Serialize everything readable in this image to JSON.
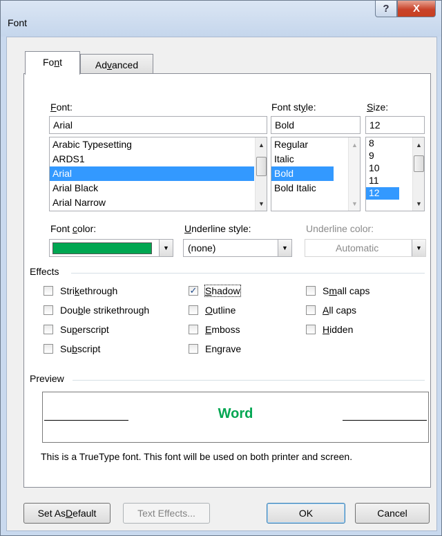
{
  "window": {
    "title": "Font",
    "help_label": "?",
    "close_label": "X"
  },
  "tabs": [
    {
      "label_pre": "Fo",
      "label_u": "n",
      "label_post": "t",
      "active": true
    },
    {
      "label_pre": "Ad",
      "label_u": "v",
      "label_post": "anced",
      "active": false
    }
  ],
  "font": {
    "label_u": "F",
    "label_post": "ont:",
    "value": "Arial",
    "list": [
      "Arabic Typesetting",
      "ARDS1",
      "Arial",
      "Arial Black",
      "Arial Narrow"
    ],
    "selected": "Arial"
  },
  "font_style": {
    "label_pre": "Font st",
    "label_u": "y",
    "label_post": "le:",
    "value": "Bold",
    "list": [
      "Regular",
      "Italic",
      "Bold",
      "Bold Italic"
    ],
    "selected": "Bold"
  },
  "size": {
    "label_u": "S",
    "label_post": "ize:",
    "value": "12",
    "list": [
      "8",
      "9",
      "10",
      "11",
      "12"
    ],
    "selected": "12"
  },
  "font_color": {
    "label_pre": "Font ",
    "label_u": "c",
    "label_post": "olor:",
    "color": "#00a651"
  },
  "underline_style": {
    "label_u": "U",
    "label_post": "nderline style:",
    "value": "(none)"
  },
  "underline_color": {
    "label": "Underline color:",
    "value": "Automatic",
    "disabled": true
  },
  "effects": {
    "heading": "Effects",
    "items": [
      {
        "pre": "Stri",
        "u": "k",
        "post": "ethrough",
        "checked": false
      },
      {
        "pre": "Dou",
        "u": "b",
        "post": "le strikethrough",
        "checked": false
      },
      {
        "pre": "Su",
        "u": "p",
        "post": "erscript",
        "checked": false
      },
      {
        "pre": "Su",
        "u": "b",
        "post": "script",
        "checked": false
      },
      {
        "pre": "",
        "u": "S",
        "post": "hadow",
        "checked": true
      },
      {
        "pre": "",
        "u": "O",
        "post": "utline",
        "checked": false
      },
      {
        "pre": "",
        "u": "E",
        "post": "mboss",
        "checked": false
      },
      {
        "pre": "En",
        "u": "g",
        "post": "rave",
        "checked": false
      },
      {
        "pre": "S",
        "u": "m",
        "post": "all caps",
        "checked": false
      },
      {
        "pre": "",
        "u": "A",
        "post": "ll caps",
        "checked": false
      },
      {
        "pre": "",
        "u": "H",
        "post": "idden",
        "checked": false
      }
    ]
  },
  "preview": {
    "heading": "Preview",
    "sample": "Word",
    "sample_color": "#00a651",
    "description": "This is a TrueType font. This font will be used on both printer and screen."
  },
  "buttons": {
    "set_default_pre": "Set As ",
    "set_default_u": "D",
    "set_default_post": "efault",
    "text_effects": "Text Effects...",
    "ok": "OK",
    "cancel": "Cancel"
  }
}
